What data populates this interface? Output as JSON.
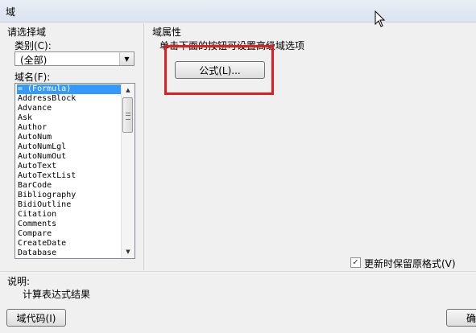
{
  "window": {
    "title": "域"
  },
  "left": {
    "section_title": "请选择域",
    "category_label": "类别(C):",
    "category_value": "(全部)",
    "fieldname_label": "域名(F):",
    "fields": [
      "= (Formula)",
      "AddressBlock",
      "Advance",
      "Ask",
      "Author",
      "AutoNum",
      "AutoNumLgl",
      "AutoNumOut",
      "AutoText",
      "AutoTextList",
      "BarCode",
      "Bibliography",
      "BidiOutline",
      "Citation",
      "Comments",
      "Compare",
      "CreateDate",
      "Database"
    ],
    "selected_index": 0
  },
  "right": {
    "section_title": "域属性",
    "instruction": "单击下面的按钮可设置高级域选项",
    "formula_button": "公式(L)...",
    "preserve_label": "更新时保留原格式(V)",
    "preserve_checked": true
  },
  "description": {
    "label": "说明:",
    "text": "计算表达式结果"
  },
  "footer": {
    "field_codes_button": "域代码(I)",
    "ok_button_partial": "确"
  },
  "colors": {
    "highlight_border": "#e21d1d",
    "selection": "#3399ff"
  }
}
